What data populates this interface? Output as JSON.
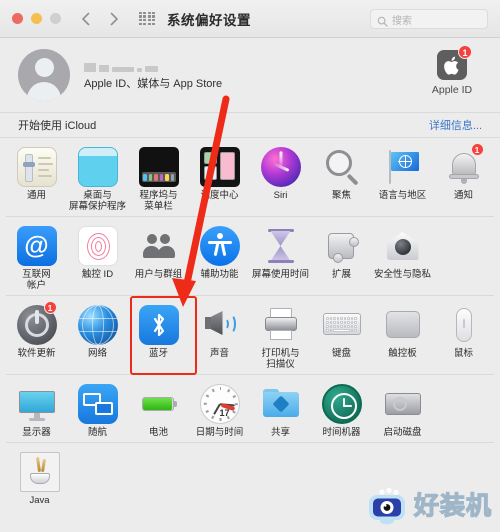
{
  "window": {
    "title": "系统偏好设置",
    "traffic_lights": [
      "close",
      "minimize",
      "zoom"
    ],
    "nav": {
      "back": "back-chevron",
      "forward": "forward-chevron",
      "grid": "show-all-grid"
    },
    "search": {
      "placeholder": "搜索",
      "value": "",
      "icon": "search-icon"
    }
  },
  "account": {
    "avatar_icon": "default-user-avatar",
    "name_redacted": true,
    "subtitle": "Apple ID、媒体与 App Store",
    "apple_id": {
      "label": "Apple ID",
      "icon": "apple-logo-icon",
      "badge": "1"
    }
  },
  "icloud_strip": {
    "left_label": "开始使用 iCloud",
    "right_label": "详细信息..."
  },
  "rows": [
    {
      "panes": [
        {
          "label": "通用",
          "icon": "general-icon",
          "badge": ""
        },
        {
          "label": "桌面与\n屏幕保护程序",
          "icon": "desktop-screensaver-icon",
          "badge": ""
        },
        {
          "label": "程序坞与\n菜单栏",
          "icon": "dock-menubar-icon",
          "badge": ""
        },
        {
          "label": "调度中心",
          "icon": "mission-control-icon",
          "badge": ""
        },
        {
          "label": "Siri",
          "icon": "siri-icon",
          "badge": ""
        },
        {
          "label": "聚焦",
          "icon": "spotlight-icon",
          "badge": ""
        },
        {
          "label": "语言与地区",
          "icon": "language-region-icon",
          "badge": ""
        },
        {
          "label": "通知",
          "icon": "notifications-icon",
          "badge": "1"
        }
      ]
    },
    {
      "panes": [
        {
          "label": "互联网\n帐户",
          "icon": "internet-accounts-icon",
          "badge": ""
        },
        {
          "label": "触控 ID",
          "icon": "touch-id-icon",
          "badge": ""
        },
        {
          "label": "用户与群组",
          "icon": "users-groups-icon",
          "badge": ""
        },
        {
          "label": "辅助功能",
          "icon": "accessibility-icon",
          "badge": ""
        },
        {
          "label": "屏幕使用时间",
          "icon": "screen-time-icon",
          "badge": ""
        },
        {
          "label": "扩展",
          "icon": "extensions-icon",
          "badge": ""
        },
        {
          "label": "安全性与隐私",
          "icon": "security-privacy-icon",
          "badge": ""
        }
      ]
    },
    {
      "panes": [
        {
          "label": "软件更新",
          "icon": "software-update-icon",
          "badge": "1"
        },
        {
          "label": "网络",
          "icon": "network-icon",
          "badge": ""
        },
        {
          "label": "蓝牙",
          "icon": "bluetooth-icon",
          "badge": ""
        },
        {
          "label": "声音",
          "icon": "sound-icon",
          "badge": ""
        },
        {
          "label": "打印机与\n扫描仪",
          "icon": "printers-scanners-icon",
          "badge": ""
        },
        {
          "label": "键盘",
          "icon": "keyboard-icon",
          "badge": ""
        },
        {
          "label": "触控板",
          "icon": "trackpad-icon",
          "badge": ""
        },
        {
          "label": "鼠标",
          "icon": "mouse-icon",
          "badge": ""
        }
      ]
    },
    {
      "panes": [
        {
          "label": "显示器",
          "icon": "displays-icon",
          "badge": ""
        },
        {
          "label": "随航",
          "icon": "sidecar-icon",
          "badge": ""
        },
        {
          "label": "电池",
          "icon": "battery-icon",
          "badge": ""
        },
        {
          "label": "日期与时间",
          "icon": "date-time-icon",
          "badge": "",
          "day": "17"
        },
        {
          "label": "共享",
          "icon": "sharing-icon",
          "badge": ""
        },
        {
          "label": "时间机器",
          "icon": "time-machine-icon",
          "badge": ""
        },
        {
          "label": "启动磁盘",
          "icon": "startup-disk-icon",
          "badge": ""
        }
      ]
    },
    {
      "panes": [
        {
          "label": "Java",
          "icon": "java-icon",
          "badge": ""
        }
      ]
    }
  ],
  "annotations": {
    "highlight_target": "蓝牙",
    "highlight_color": "#ee2b18",
    "arrow_color": "#ee2b18",
    "arrow_from": "top-right",
    "arrow_to": "bluetooth-pane"
  },
  "watermark": {
    "text": "好装机",
    "logo_icon": "monitor-eye-logo"
  }
}
